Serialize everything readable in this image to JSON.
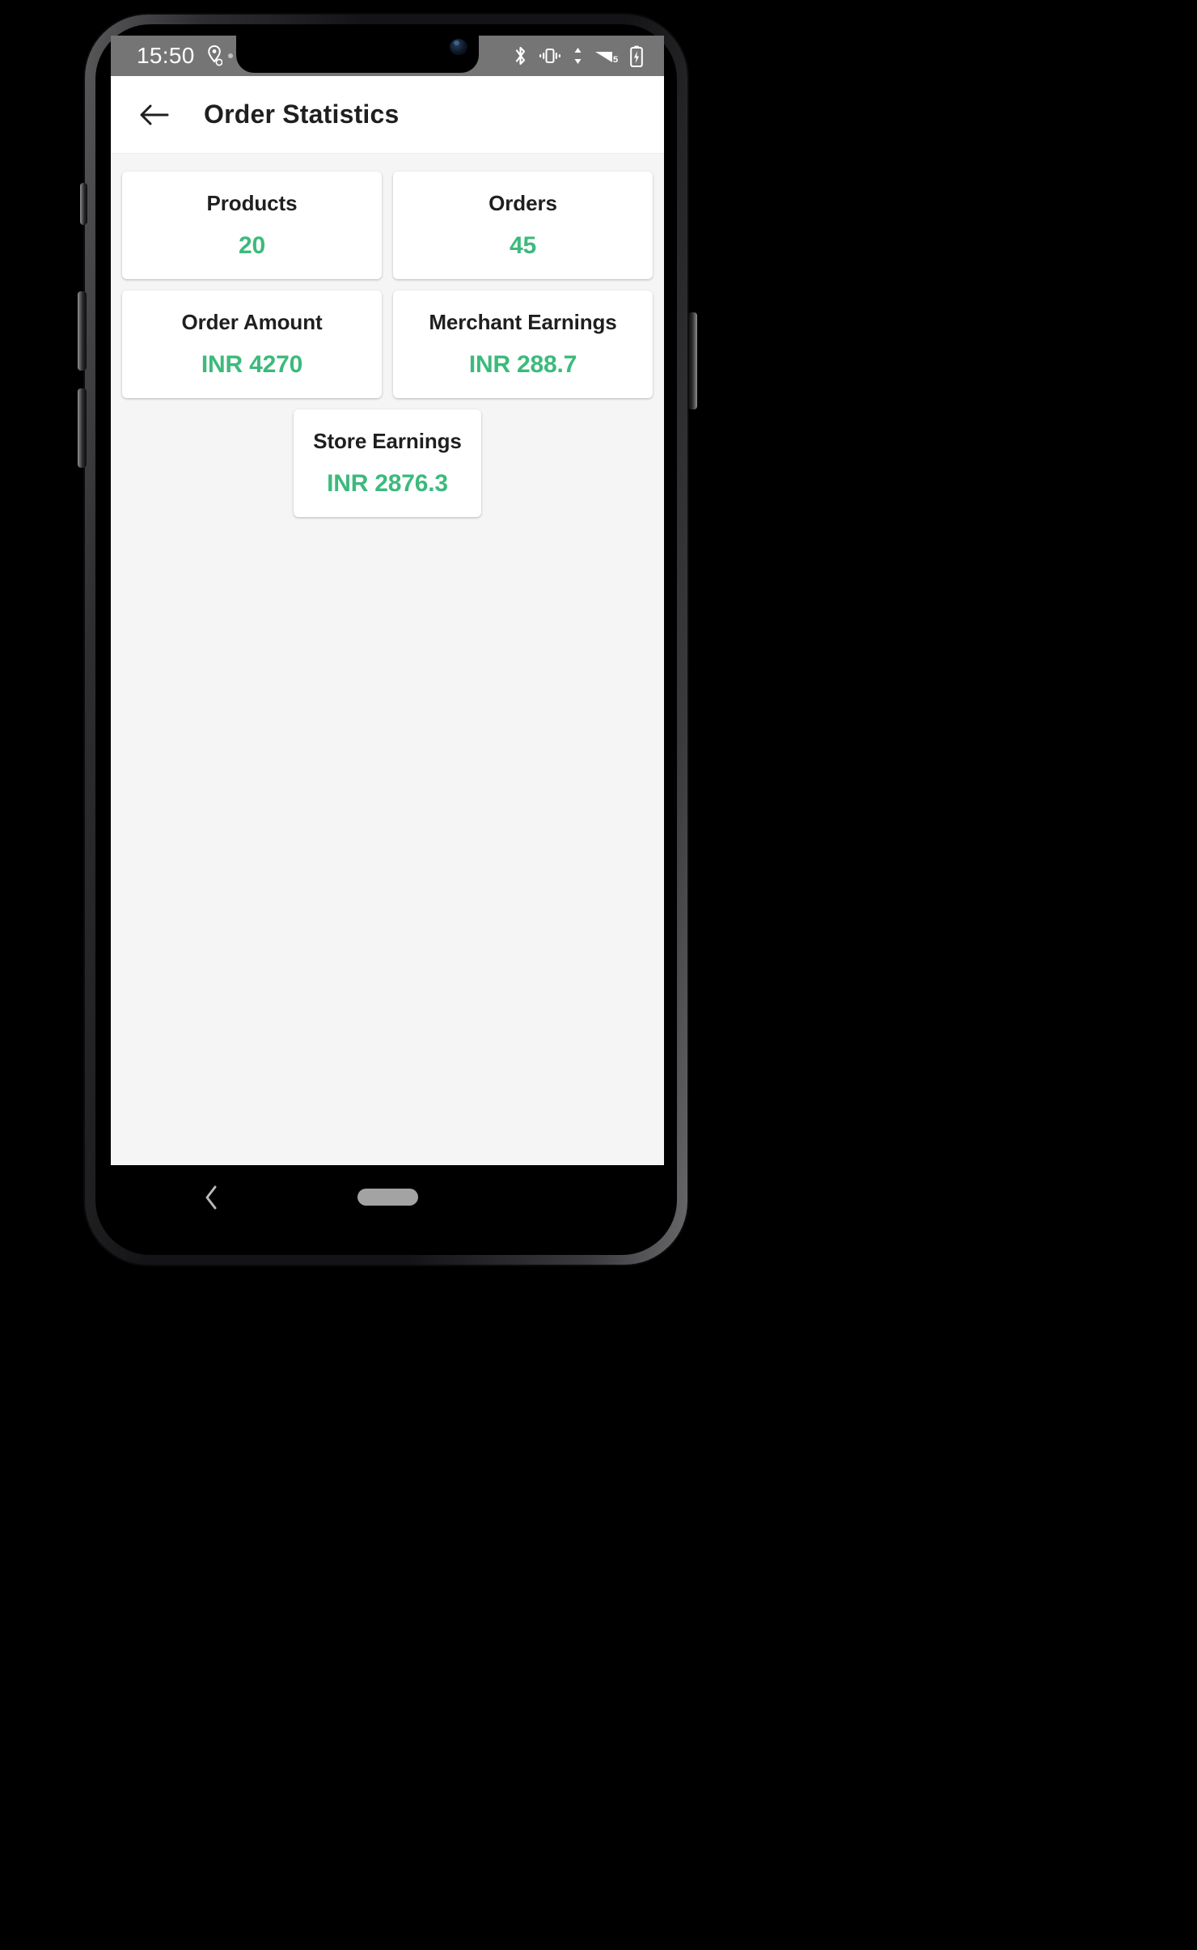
{
  "status_bar": {
    "clock": "15:50",
    "left_icons": [
      "location-icon",
      "app-badge-icon"
    ],
    "right_icons": [
      "bluetooth-icon",
      "vibrate-icon",
      "data-transfer-icon",
      "wifi-icon",
      "battery-charging-icon"
    ],
    "wifi_label": "5",
    "background_color": "#757575"
  },
  "app_bar": {
    "back_icon": "arrow-left-icon",
    "title": "Order Statistics"
  },
  "theme": {
    "accent_green": "#3cba7c",
    "page_background": "#f5f5f5",
    "card_background": "#ffffff",
    "title_color": "#1f1f1f"
  },
  "stats": {
    "row1": [
      {
        "label": "Products",
        "value": "20"
      },
      {
        "label": "Orders",
        "value": "45"
      }
    ],
    "row2": [
      {
        "label": "Order Amount",
        "value": "INR 4270"
      },
      {
        "label": "Merchant Earnings",
        "value": "INR 288.7"
      }
    ],
    "row3": [
      {
        "label": "Store Earnings",
        "value": "INR 2876.3"
      }
    ]
  },
  "nav_bar": {
    "back_icon": "chevron-left-icon",
    "home_indicator": "home-pill-icon"
  }
}
